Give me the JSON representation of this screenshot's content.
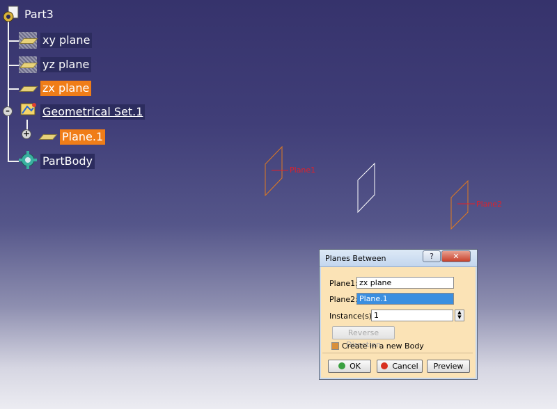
{
  "tree": {
    "root": "Part3",
    "items": [
      {
        "label": "xy plane"
      },
      {
        "label": "yz plane"
      },
      {
        "label": "zx plane"
      },
      {
        "label": "Geometrical Set.1"
      },
      {
        "label": "Plane.1"
      },
      {
        "label": "PartBody"
      }
    ]
  },
  "viewport": {
    "labels": [
      "Plane1",
      "Plane2"
    ],
    "colors": {
      "selected": "#e07a20",
      "preview": "#ffffff",
      "annotation": "#e0202a"
    }
  },
  "dialog": {
    "title": "Planes Between",
    "help": "?",
    "close": "✕",
    "plane1_label": "Plane1:",
    "plane1_value": "zx plane",
    "plane2_label": "Plane2:",
    "plane2_value": "Plane.1",
    "instances_label": "Instance(s):",
    "instances_value": "1",
    "reverse_label": "Reverse Direction",
    "create_body_label": "Create in a new Body",
    "ok_label": "OK",
    "cancel_label": "Cancel",
    "preview_label": "Preview"
  }
}
